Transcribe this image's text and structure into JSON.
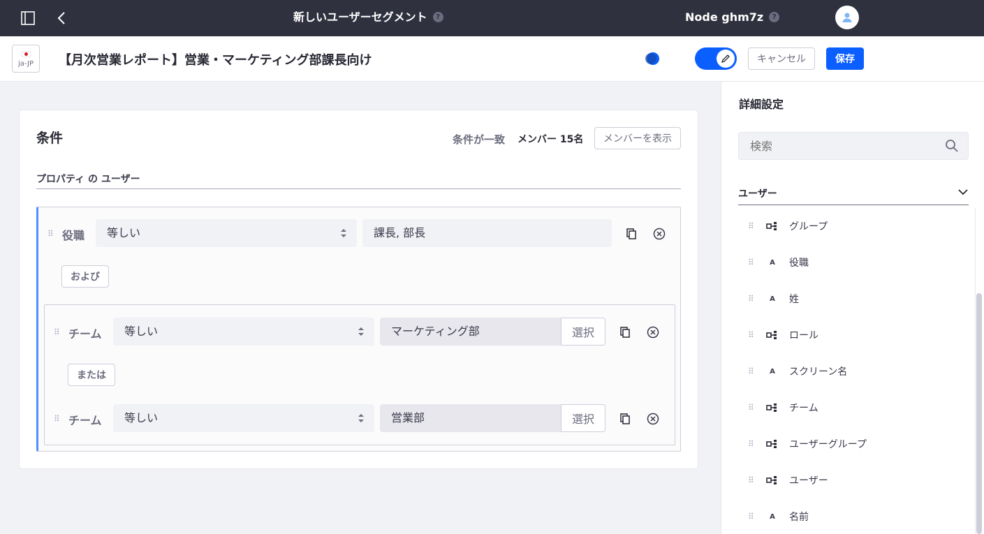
{
  "topbar": {
    "segment_title": "新しいユーザーセグメント",
    "site_title": "Node ghm7z",
    "help": "?"
  },
  "header": {
    "locale": "ja-JP",
    "title": "【月次営業レポート】営業・マーケティング部課長向け",
    "cancel_label": "キャンセル",
    "save_label": "保存",
    "accent_color": "#0b5fff"
  },
  "conditions": {
    "title": "条件",
    "match_text": "条件が一致",
    "member_count": "メンバー 15名",
    "view_members_label": "メンバーを表示",
    "property_label": "プロパティ の ユーザー",
    "rows": [
      {
        "field": "役職",
        "operator": "等しい",
        "value": "課長, 部長"
      },
      {
        "field": "チーム",
        "operator": "等しい",
        "value": "マーケティング部",
        "select_label": "選択"
      },
      {
        "field": "チーム",
        "operator": "等しい",
        "value": "営業部",
        "select_label": "選択"
      }
    ],
    "conj_and": "および",
    "conj_or": "または"
  },
  "sidebar": {
    "title": "詳細設定",
    "search_placeholder": "検索",
    "section": "ユーザー",
    "items": [
      {
        "label": "グループ",
        "type": "entity"
      },
      {
        "label": "役職",
        "type": "A"
      },
      {
        "label": "姓",
        "type": "A"
      },
      {
        "label": "ロール",
        "type": "entity"
      },
      {
        "label": "スクリーン名",
        "type": "A"
      },
      {
        "label": "チーム",
        "type": "entity"
      },
      {
        "label": "ユーザーグループ",
        "type": "entity"
      },
      {
        "label": "ユーザー",
        "type": "entity"
      },
      {
        "label": "名前",
        "type": "A"
      }
    ]
  }
}
